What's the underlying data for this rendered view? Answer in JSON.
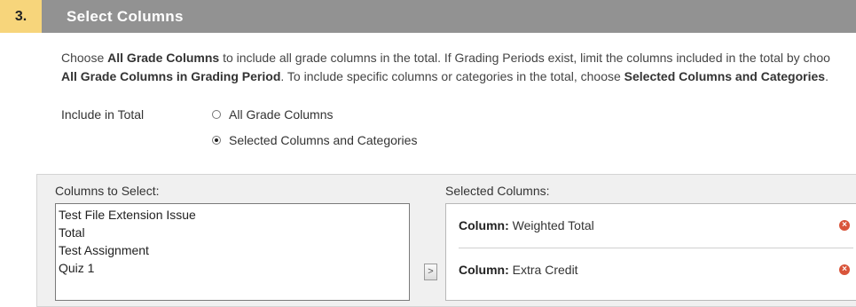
{
  "step": {
    "number": "3.",
    "title": "Select Columns"
  },
  "instructions": {
    "line1": [
      {
        "text": "Choose ",
        "bold": false
      },
      {
        "text": "All Grade Columns",
        "bold": true
      },
      {
        "text": " to include all grade columns in the total. If Grading Periods exist, limit the columns included in the total by choo",
        "bold": false
      }
    ],
    "line2": [
      {
        "text": "All Grade Columns in Grading Period",
        "bold": true
      },
      {
        "text": ". To include specific columns or categories in the total, choose ",
        "bold": false
      },
      {
        "text": "Selected Columns and Categories",
        "bold": true
      },
      {
        "text": ".",
        "bold": false
      }
    ]
  },
  "include_in_total": {
    "label": "Include in Total",
    "options": [
      {
        "label": "All Grade Columns",
        "checked": false
      },
      {
        "label": "Selected Columns and Categories",
        "checked": true
      }
    ]
  },
  "columns_to_select": {
    "label": "Columns to Select:",
    "items": [
      "Test File Extension Issue",
      "Total",
      "Test Assignment",
      "Quiz 1"
    ]
  },
  "move_button": {
    "glyph": ">"
  },
  "selected_columns": {
    "label": "Selected Columns:",
    "items": [
      {
        "prefix": "Column:",
        "name": "Weighted Total"
      },
      {
        "prefix": "Column:",
        "name": "Extra Credit"
      }
    ],
    "remove_glyph": "×"
  },
  "colors": {
    "header_bg": "#929292",
    "step_number_bg": "#f7d57b",
    "remove_icon": "#d9543a"
  }
}
